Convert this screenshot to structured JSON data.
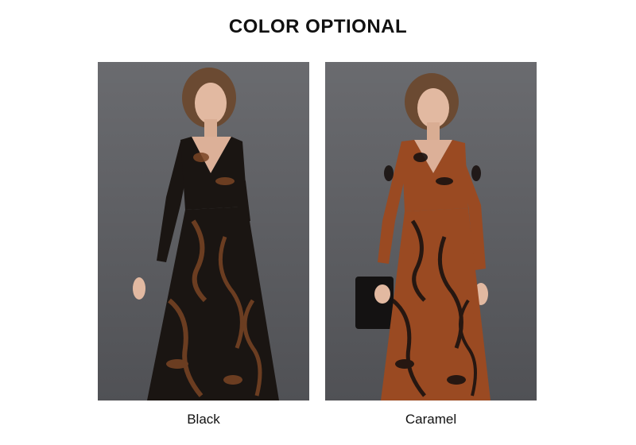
{
  "page": {
    "title": "COLOR OPTIONAL"
  },
  "variants": [
    {
      "label": "Black",
      "dress_color": "#1a1512",
      "pattern_color": "#7a4424"
    },
    {
      "label": "Caramel",
      "dress_color": "#9a4a22",
      "pattern_color": "#1a1210"
    }
  ],
  "colors": {
    "backdrop": "#5f6064",
    "skin": "#e2b9a1",
    "hair": "#6b4a32",
    "text": "#111111"
  }
}
